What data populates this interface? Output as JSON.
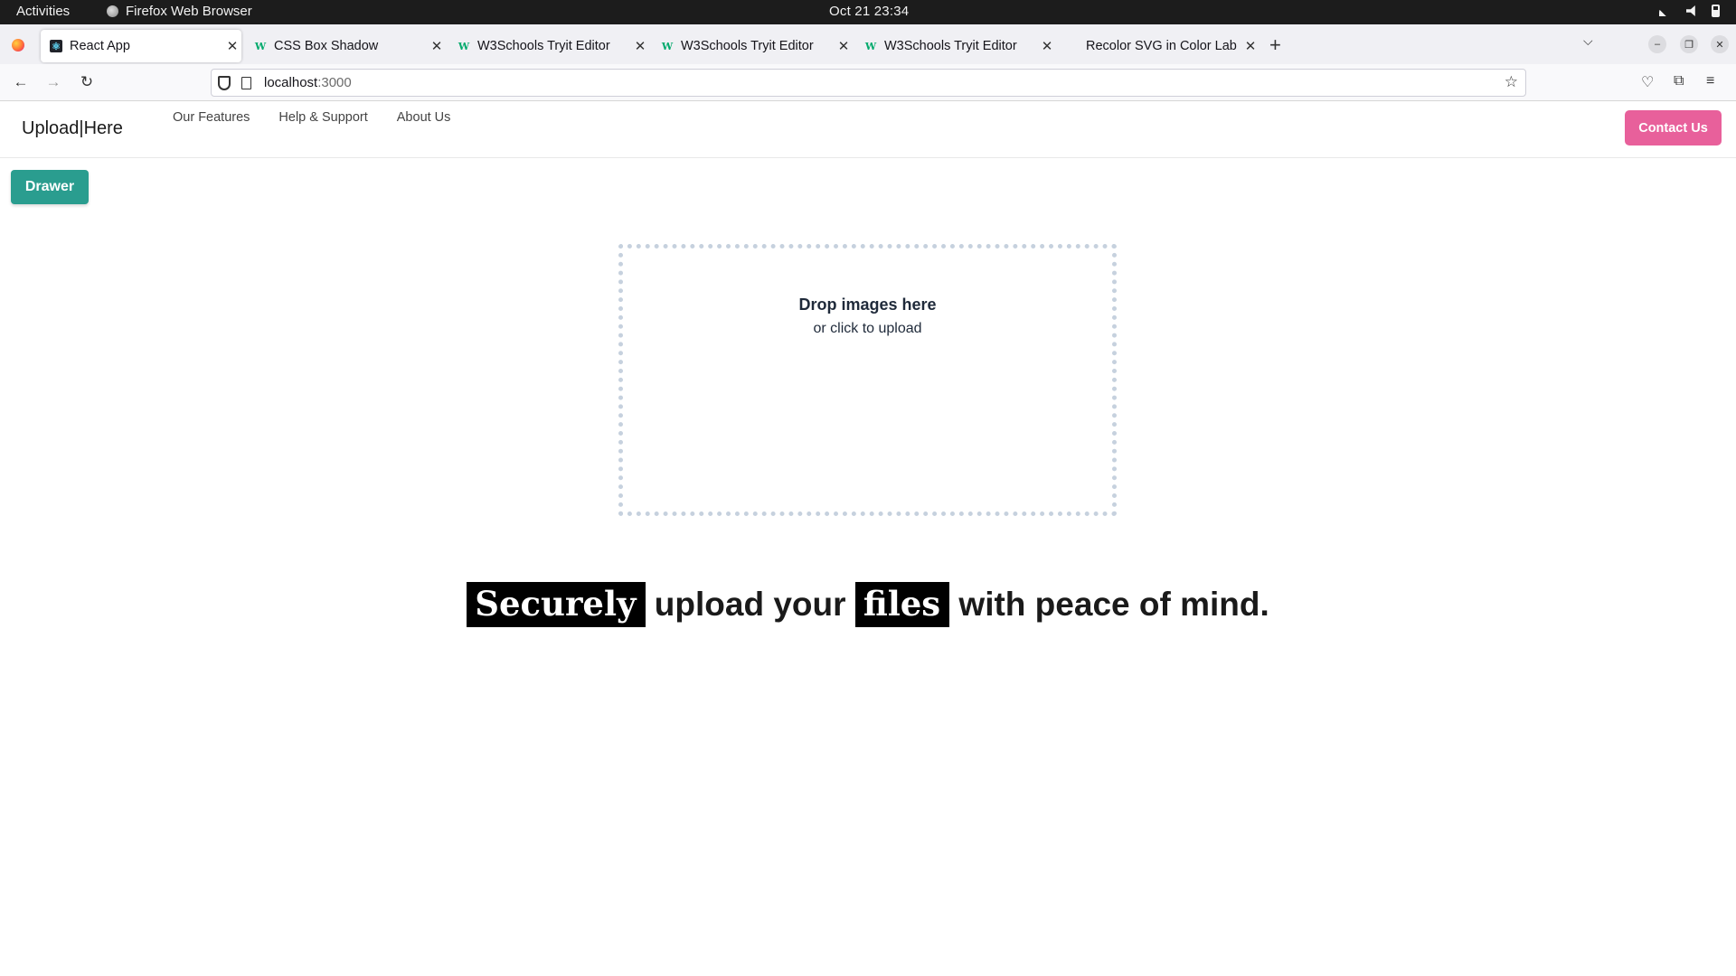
{
  "system": {
    "activities": "Activities",
    "app_name": "Firefox Web Browser",
    "clock": "Oct 21  23:34"
  },
  "browser": {
    "tabs": [
      {
        "title": "React App",
        "favicon": "react-icon",
        "active": true
      },
      {
        "title": "CSS Box Shadow",
        "favicon": "w3schools-icon",
        "active": false
      },
      {
        "title": "W3Schools Tryit Editor",
        "favicon": "w3schools-icon",
        "active": false
      },
      {
        "title": "W3Schools Tryit Editor",
        "favicon": "w3schools-icon",
        "active": false
      },
      {
        "title": "W3Schools Tryit Editor",
        "favicon": "w3schools-icon",
        "active": false
      },
      {
        "title": "Recolor SVG in Color Lab",
        "favicon": "none",
        "active": false
      }
    ],
    "url_host": "localhost",
    "url_port": ":3000"
  },
  "app": {
    "brand": "Upload|Here",
    "nav": {
      "features": "Our Features",
      "help": "Help & Support",
      "about": "About Us"
    },
    "contact_label": "Contact Us",
    "drawer_label": "Drawer",
    "dropzone": {
      "title": "Drop images here",
      "subtitle": "or click to upload"
    },
    "tagline": {
      "word1": "Securely",
      "text1": " upload your ",
      "word2": "files",
      "text2": " with peace of mind."
    }
  },
  "colors": {
    "contact_button": "#e8609b",
    "drawer_button": "#2a9d8f",
    "dropzone_border": "#c6d1de"
  }
}
